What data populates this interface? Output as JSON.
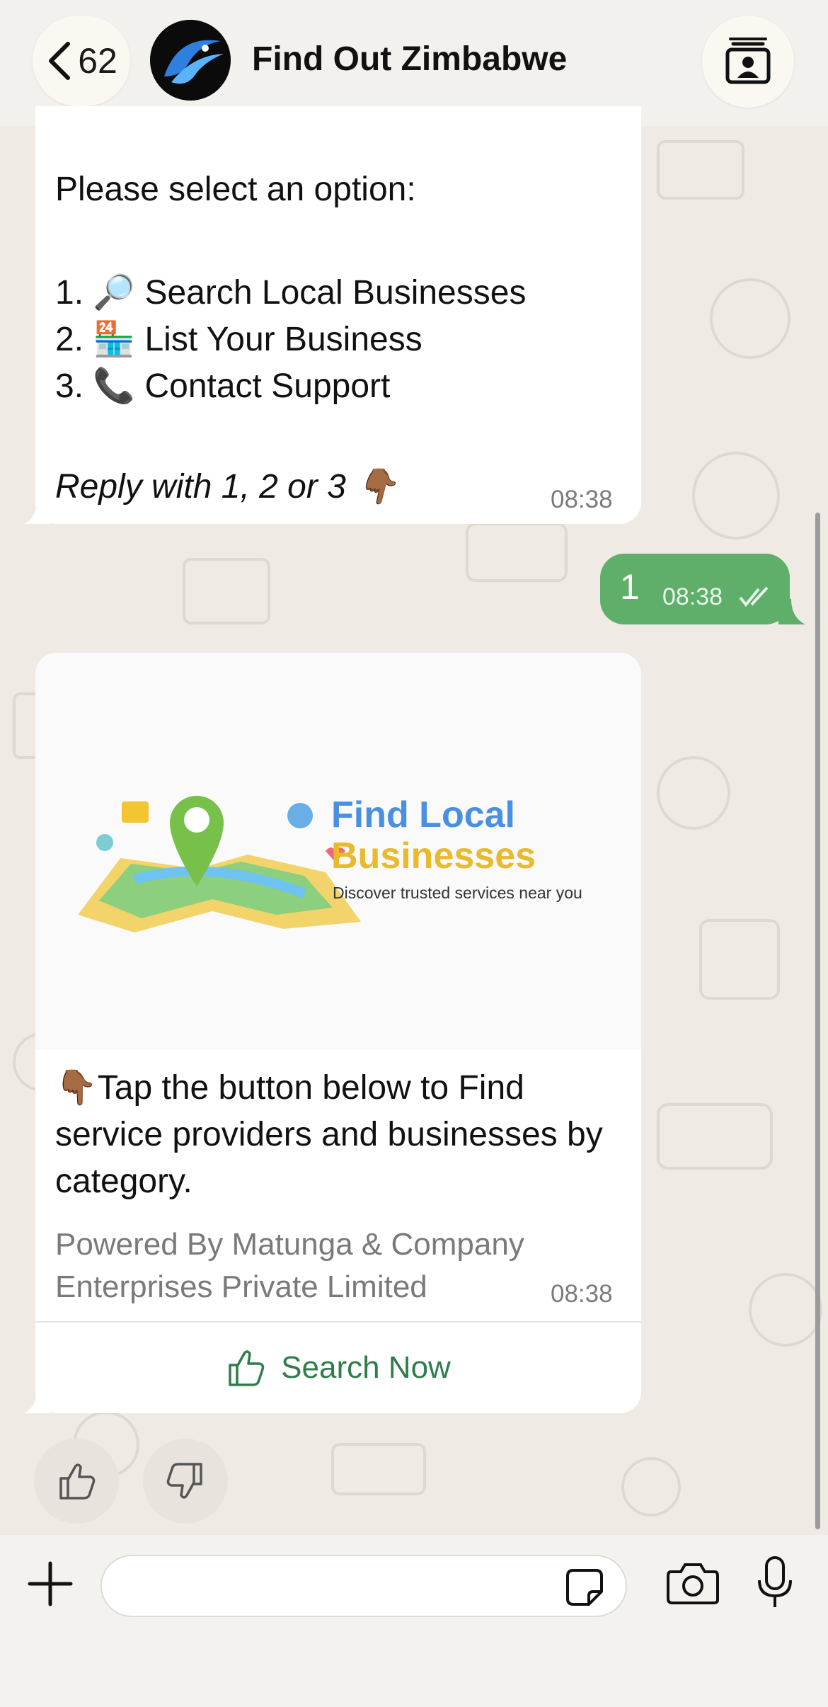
{
  "header": {
    "back_count": "62",
    "chat_title": "Find Out Zimbabwe",
    "icons": {
      "back": "chevron-left-icon",
      "contact": "contact-card-icon"
    }
  },
  "messages": {
    "menu": {
      "prompt": "Please select an option:",
      "option1": "1. 🔎 Search Local Businesses",
      "option2": "2. 🏪 List Your Business",
      "option3": "3. 📞 Contact Support",
      "reply_hint": "Reply with 1, 2 or 3 👇🏾",
      "time": "08:38"
    },
    "user_reply": {
      "text": "1",
      "time": "08:38",
      "status": "read"
    },
    "listing": {
      "banner_title_line1": "Find Local",
      "banner_title_line2": "Businesses",
      "banner_subtitle": "Discover trusted services near you",
      "caption": "👇🏾Tap the button below to Find service providers and businesses by category.",
      "footer": "Powered By Matunga & Company Enterprises Private Limited",
      "time": "08:38",
      "button_label": "Search Now"
    }
  },
  "reactions": {
    "like": "thumbs-up-icon",
    "dislike": "thumbs-down-icon"
  },
  "composer": {
    "value": "",
    "placeholder": ""
  },
  "colors": {
    "background": "#efebe4",
    "outgoing_bubble": "#5fae6a",
    "button_text": "#2f7d4a",
    "banner_blue": "#4a90e2",
    "banner_yellow": "#e9b92e"
  }
}
